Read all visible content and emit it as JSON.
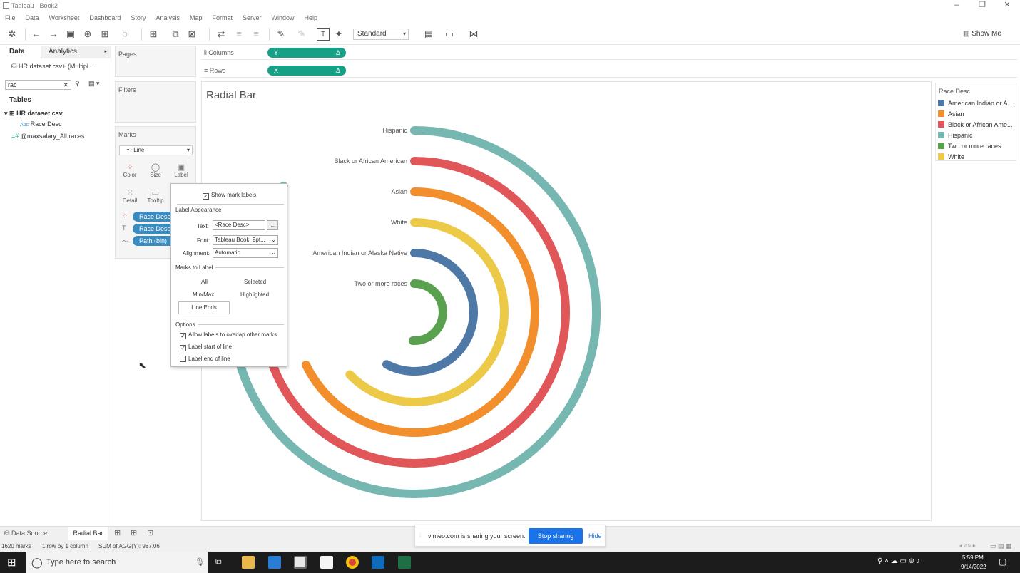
{
  "window": {
    "title": "Tableau - Book2"
  },
  "menu": [
    "File",
    "Data",
    "Worksheet",
    "Dashboard",
    "Story",
    "Analysis",
    "Map",
    "Format",
    "Server",
    "Window",
    "Help"
  ],
  "toolbar": {
    "fit_select": "Standard",
    "show_me": "Show Me"
  },
  "left_pane": {
    "tabs": [
      "Data",
      "Analytics"
    ],
    "datasource": "HR dataset.csv+ (Multipl...",
    "search_value": "rac",
    "tables_heading": "Tables",
    "table_name": "HR dataset.csv",
    "fields": [
      "Race Desc",
      "@maxsalary_All races"
    ]
  },
  "shelves": {
    "pages": "Pages",
    "filters": "Filters",
    "marks": "Marks",
    "mark_type": "Line",
    "columns_label": "Columns",
    "rows_label": "Rows",
    "columns_pill": "Y",
    "rows_pill": "X",
    "mark_buttons": [
      "Color",
      "Size",
      "Label",
      "Detail",
      "Tooltip"
    ],
    "mark_pills": [
      "Race Desc",
      "Race Desc",
      "Path (bin)"
    ]
  },
  "view": {
    "title": "Radial Bar"
  },
  "legend": {
    "title": "Race Desc",
    "items": [
      {
        "label": "American Indian or A...",
        "color": "#4e79a7"
      },
      {
        "label": "Asian",
        "color": "#f28e2b"
      },
      {
        "label": "Black or African Ame...",
        "color": "#e15759"
      },
      {
        "label": "Hispanic",
        "color": "#76b7b2"
      },
      {
        "label": "Two or more races",
        "color": "#59a14f"
      },
      {
        "label": "White",
        "color": "#edc948"
      }
    ]
  },
  "chart_data": {
    "type": "radial-bar",
    "title": "Radial Bar",
    "categories": [
      "Hispanic",
      "Black or African American",
      "Asian",
      "White",
      "American Indian or Alaska Native",
      "Two or more races"
    ],
    "colors": [
      "#76b7b2",
      "#e15759",
      "#f28e2b",
      "#edc948",
      "#4e79a7",
      "#59a14f"
    ],
    "sweep_degrees": [
      314,
      278,
      244,
      226,
      208,
      183
    ]
  },
  "label_popup": {
    "show_mark_labels": "Show mark labels",
    "label_appearance": "Label Appearance",
    "text_label": "Text:",
    "text_value": "<Race Desc>",
    "font_label": "Font:",
    "font_value": "Tableau Book, 9pt...",
    "alignment_label": "Alignment:",
    "alignment_value": "Automatic",
    "marks_to_label": "Marks to Label",
    "all": "All",
    "selected": "Selected",
    "minmax": "Min/Max",
    "highlighted": "Highlighted",
    "line_ends": "Line Ends",
    "options": "Options",
    "opt_overlap": "Allow labels to overlap other marks",
    "opt_start": "Label start of line",
    "opt_end": "Label end of line"
  },
  "sheet_tabs": {
    "data_source": "Data Source",
    "active_sheet": "Radial Bar"
  },
  "status": {
    "marks": "1620 marks",
    "rows": "1 row by 1 column",
    "sum": "SUM of AGG(Y): 987.06"
  },
  "share_bar": {
    "message": "vimeo.com is sharing your screen.",
    "stop": "Stop sharing",
    "hide": "Hide"
  },
  "taskbar": {
    "search": "Type here to search",
    "time": "5:59 PM",
    "date": "9/14/2022"
  }
}
